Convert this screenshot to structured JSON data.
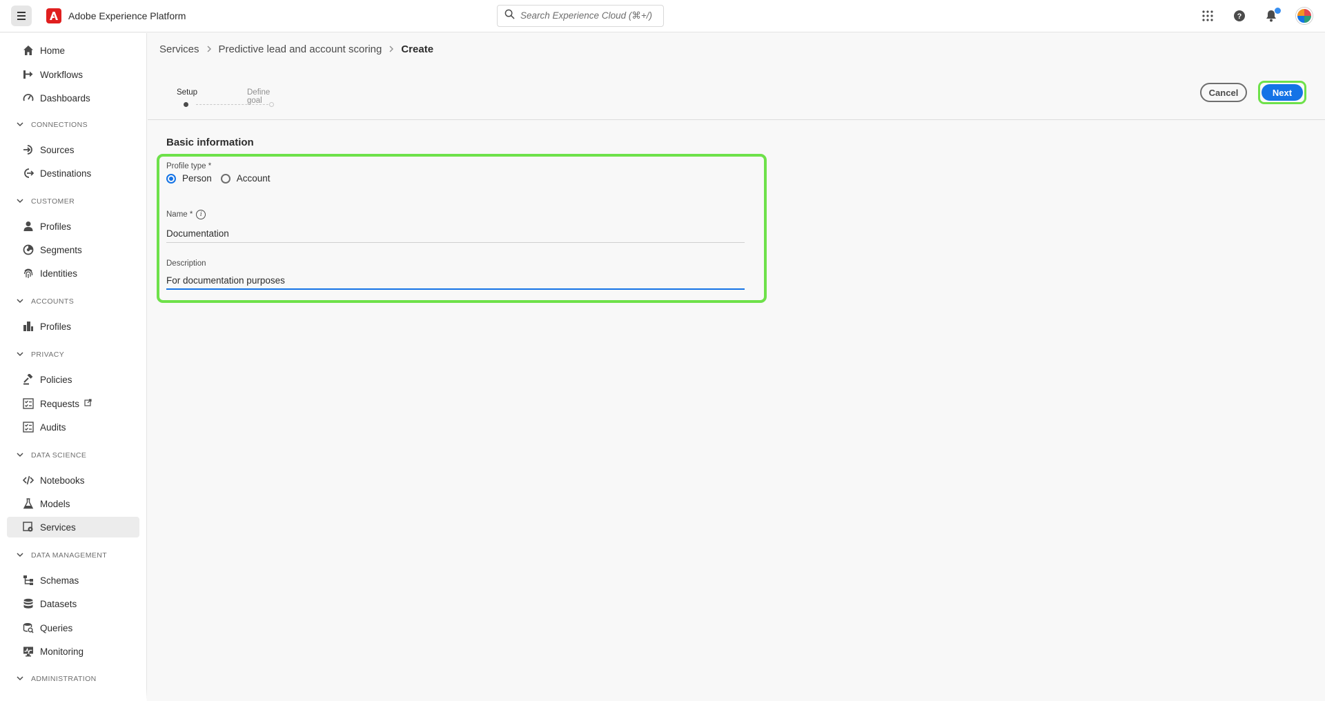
{
  "header": {
    "app_title": "Adobe Experience Platform",
    "search_placeholder": "Search Experience Cloud (⌘+/)"
  },
  "sidebar": {
    "top_items": [
      {
        "label": "Home",
        "icon": "home-icon"
      },
      {
        "label": "Workflows",
        "icon": "workflow-icon"
      },
      {
        "label": "Dashboards",
        "icon": "dashboard-icon"
      }
    ],
    "sections": [
      {
        "title": "CONNECTIONS",
        "items": [
          {
            "label": "Sources",
            "icon": "sources-icon"
          },
          {
            "label": "Destinations",
            "icon": "destinations-icon"
          }
        ]
      },
      {
        "title": "CUSTOMER",
        "items": [
          {
            "label": "Profiles",
            "icon": "user-icon"
          },
          {
            "label": "Segments",
            "icon": "segments-icon"
          },
          {
            "label": "Identities",
            "icon": "fingerprint-icon"
          }
        ]
      },
      {
        "title": "ACCOUNTS",
        "items": [
          {
            "label": "Profiles",
            "icon": "building-icon"
          }
        ]
      },
      {
        "title": "PRIVACY",
        "items": [
          {
            "label": "Policies",
            "icon": "gavel-icon"
          },
          {
            "label": "Requests",
            "icon": "checklist-icon"
          },
          {
            "label": "Audits",
            "icon": "checklist-icon"
          }
        ]
      },
      {
        "title": "DATA SCIENCE",
        "items": [
          {
            "label": "Notebooks",
            "icon": "code-icon"
          },
          {
            "label": "Models",
            "icon": "beaker-icon"
          },
          {
            "label": "Services",
            "icon": "services-icon",
            "active": true
          }
        ]
      },
      {
        "title": "DATA MANAGEMENT",
        "items": [
          {
            "label": "Schemas",
            "icon": "schema-icon"
          },
          {
            "label": "Datasets",
            "icon": "database-icon"
          },
          {
            "label": "Queries",
            "icon": "query-icon"
          },
          {
            "label": "Monitoring",
            "icon": "monitoring-icon"
          }
        ]
      },
      {
        "title": "ADMINISTRATION",
        "items": []
      }
    ]
  },
  "breadcrumb": {
    "items": [
      "Services",
      "Predictive lead and account scoring"
    ],
    "current": "Create"
  },
  "steps": [
    {
      "label": "Setup",
      "state": "current"
    },
    {
      "label": "Define goal",
      "state": "pending"
    }
  ],
  "actions": {
    "cancel": "Cancel",
    "next": "Next"
  },
  "form": {
    "section_title": "Basic information",
    "profile_type": {
      "label": "Profile type *",
      "options": [
        "Person",
        "Account"
      ],
      "selected": "Person"
    },
    "name": {
      "label": "Name *",
      "value": "Documentation"
    },
    "description": {
      "label": "Description",
      "value": "For documentation purposes"
    }
  },
  "colors": {
    "accent": "#1473e6",
    "highlight": "#6ee14a",
    "logo": "#e01f1f"
  }
}
